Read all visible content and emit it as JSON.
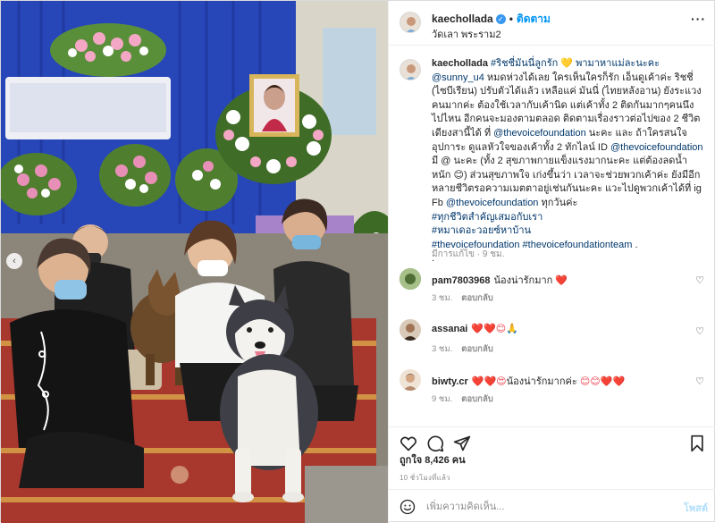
{
  "photo": {
    "alt": "",
    "prev_icon": "chevron-left-icon"
  },
  "header": {
    "username": "kaechollada",
    "verified_icon": "verified-badge-icon",
    "separator": "•",
    "follow_label": "ติดตาม",
    "location": "วัดเลา พระราม2",
    "more_icon": "more-horizontal-icon",
    "more_label": "···"
  },
  "caption": {
    "username": "kaechollada",
    "line1": "#ริชชี่มันนี่ลูกรัก 💛 พามาหาแม่ละนะคะ",
    "line2_tag": "@sunny_u4",
    "line2_rest": " หมดห่วงได้เลย ใครเห็นใครก็รัก เอ็นดูเค้าค่ะ ริชชี่ (ไซบีเรียน) ปรับตัวได้แล้ว เหลือแค่ มันนี่ (ไทยหลังอาน) ยังระแวงคนมากค่ะ ต้องใช้เวลากับเค้านิด แต่เค้าทั้ง 2 ติดกันมากๆคนนึงไปไหน อีกคนจะมองตามตลอด ติดตามเรื่องราวต่อไปของ 2 ชีวิตเดียงสานี้ได้ ที่ ",
    "tag_foundation": "@thevoicefoundation",
    "line3": " นะคะ และ ถ้าใครสนใจอุปการะ ดูแลหัวใจของเค้าทั้ง 2 ทักไลน์ ID ",
    "tag_foundation2": "@thevoicefoundation",
    "line4": " มี @ นะคะ (ทั้ง 2 สุขภาพกายแข็งแรงมากนะคะ แต่ต้องลดน้ำหนัก 😊) ส่วนสุขภาพใจ เก่งขึ้นว่า เวลาจะช่วยพวกเค้าค่ะ ยังมีอีกหลายชีวิตรอความเมตตาอยู่เช่นกันนะคะ แวะไปดูพวกเค้าได้ที่ ig Fb ",
    "tag_foundation3": "@thevoicefoundation",
    "line5": " ทุกวันค่ะ",
    "hashtag1": "#ทุกชีวิตสำคัญเสมอกับเรา",
    "hashtag2": "#หมาเดอะวอยซ์หาบ้าน",
    "hashtag3": "#thevoicefoundation",
    "hashtag4": "#thevoicefoundationteam",
    "trail": " .",
    "dot": ".",
    "meta": "มีการแก้ไข · 9 ชม."
  },
  "comments": [
    {
      "username": "pam7803968",
      "text": "น้องน่ารักมาก",
      "emoji": "❤️",
      "time": "3 ชม.",
      "reply": "ตอบกลับ",
      "avatar_color": "#6f8d52"
    },
    {
      "username": "assanai",
      "text": "",
      "emoji": "❤️❤️😊🙏",
      "time": "3 ชม.",
      "reply": "ตอบกลับ",
      "avatar_color": "#3a2a22"
    },
    {
      "username": "biwty.cr",
      "text": "น้องน่ารักมากค่ะ",
      "emoji_pre": "❤️❤️😍",
      "emoji": "😊😊❤️❤️",
      "time": "9 ชม.",
      "reply": "ตอบกลับ",
      "avatar_color": "#b58a6e"
    }
  ],
  "actions": {
    "like_icon": "heart-icon",
    "comment_icon": "comment-icon",
    "share_icon": "send-icon",
    "save_icon": "bookmark-icon"
  },
  "likes_text": "ถูกใจ 8,426 คน",
  "time_ago": "10 ชั่วโมงที่แล้ว",
  "add_comment": {
    "emoji_icon": "smile-icon",
    "placeholder": "เพิ่มความคิดเห็น...",
    "post_label": "โพสต์"
  },
  "colors": {
    "accent": "#0095f6",
    "link": "#00376b",
    "heart": "#ed4956"
  }
}
